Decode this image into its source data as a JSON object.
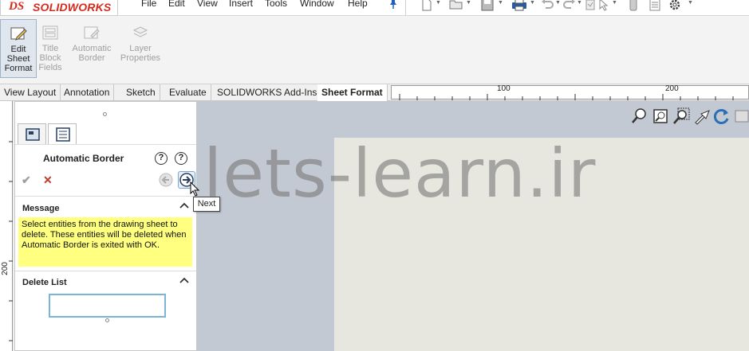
{
  "app": {
    "logo_ds": "DS",
    "logo_text": "SOLIDWORKS"
  },
  "menu": [
    "File",
    "Edit",
    "View",
    "Insert",
    "Tools",
    "Window",
    "Help"
  ],
  "ribbon": {
    "buttons": [
      {
        "line1": "Edit",
        "line2": "Sheet",
        "line3": "Format",
        "state": "active"
      },
      {
        "line1": "Title",
        "line2": "Block",
        "line3": "Fields",
        "state": "disabled"
      },
      {
        "line1": "Automatic",
        "line2": "Border",
        "line3": "",
        "state": "disabled"
      },
      {
        "line1": "Layer",
        "line2": "Properties",
        "line3": "",
        "state": "disabled"
      }
    ]
  },
  "tabs": [
    "View Layout",
    "Annotation",
    "Sketch",
    "Evaluate",
    "SOLIDWORKS Add-Ins",
    "Sheet Format"
  ],
  "ruler": {
    "h_100": "100",
    "h_200": "200",
    "v_200": "200"
  },
  "property_manager": {
    "title": "Automatic Border",
    "help_glyph": "?",
    "ok_glyph": "✔",
    "cancel_glyph": "✕",
    "message_section": {
      "heading": "Message",
      "text": "Select entities from the drawing sheet to delete. These entities will be deleted when Automatic Border is exited with OK."
    },
    "delete_list_section": {
      "heading": "Delete List"
    }
  },
  "tooltip": {
    "text": "Next"
  },
  "watermark": "lets-learn.ir",
  "colors": {
    "brand_red": "#d52b1e",
    "message_bg": "#ffff80",
    "graphics_bg": "#c3c9d3",
    "sheet_bg": "#e7e6df",
    "selection_box_border": "#7ab4d9"
  },
  "icons": {
    "heads_up_view_toolbar": [
      "zoom-to-fit-icon",
      "zoom-to-area-icon",
      "zoom-in-out-icon",
      "pan-icon",
      "rotate-icon",
      "more-icon"
    ],
    "quick_access": [
      "new-document-icon",
      "open-icon",
      "save-icon",
      "print-icon",
      "undo-icon",
      "redo-icon",
      "rebuild-icon",
      "select-icon",
      "file-properties-icon",
      "options-icon",
      "settings-gear-icon"
    ]
  }
}
